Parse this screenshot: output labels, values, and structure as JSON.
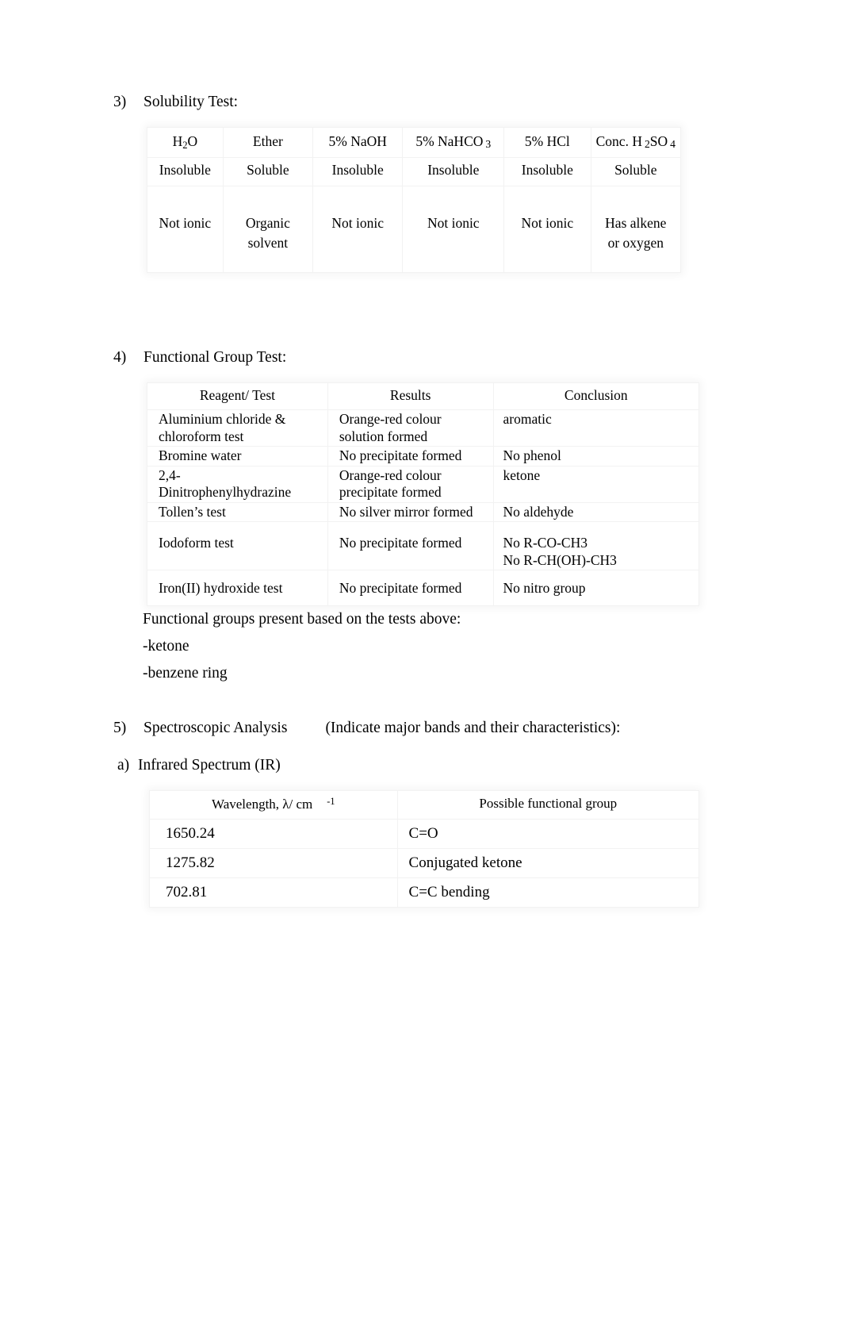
{
  "document": {
    "type": "lab-report-page",
    "background_color": "#ffffff",
    "text_color": "#000000"
  },
  "sections": {
    "solubility": {
      "marker": "3)",
      "title": "Solubility Test:",
      "table": {
        "headers": [
          {
            "text": "H",
            "sub": "2",
            "tail": "O"
          },
          {
            "text": "Ether",
            "sub": "",
            "tail": ""
          },
          {
            "text": "5% NaOH",
            "sub": "",
            "tail": ""
          },
          {
            "text": "5% NaHCO",
            "sub": "3",
            "tail": ""
          },
          {
            "text": "5% HCl",
            "sub": "",
            "tail": ""
          },
          {
            "text": "Conc. H",
            "sub": "2",
            "tail": "SO",
            "sub2": "4"
          }
        ],
        "header_plain": [
          "H2O",
          "Ether",
          "5% NaOH",
          "5% NaHCO 3",
          "5% HCl",
          "Conc. H 2SO 4"
        ],
        "results": [
          "Insoluble",
          "Soluble",
          "Insoluble",
          "Insoluble",
          "Insoluble",
          "Soluble"
        ],
        "conclusions": [
          [
            "Not ionic"
          ],
          [
            "Organic",
            "solvent"
          ],
          [
            "Not ionic"
          ],
          [
            "Not ionic"
          ],
          [
            "Not ionic"
          ],
          [
            "Has alkene",
            "or oxygen"
          ]
        ]
      }
    },
    "functional_group": {
      "marker": "4)",
      "title": "Functional Group Test:",
      "table": {
        "headers": [
          "Reagent/ Test",
          "Results",
          "Conclusion"
        ],
        "rows": [
          {
            "reagent": [
              "Aluminium chloride &",
              "chloroform test"
            ],
            "results": [
              "Orange-red colour",
              "solution formed"
            ],
            "conclusion": [
              "aromatic"
            ]
          },
          {
            "reagent": [
              "Bromine water"
            ],
            "results": [
              "No precipitate formed"
            ],
            "conclusion": [
              "No phenol"
            ]
          },
          {
            "reagent": [
              "2,4-",
              "Dinitrophenylhydrazine"
            ],
            "results": [
              "Orange-red colour",
              "precipitate formed"
            ],
            "conclusion": [
              "ketone"
            ]
          },
          {
            "reagent": [
              "Tollen’s test"
            ],
            "results": [
              "No silver mirror formed"
            ],
            "conclusion": [
              "No aldehyde"
            ]
          },
          {
            "reagent": [
              "Iodoform test"
            ],
            "results": [
              "No precipitate formed"
            ],
            "conclusion": [
              "No  R-CO-CH3",
              "No  R-CH(OH)-CH3"
            ]
          },
          {
            "reagent": [
              "Iron(II) hydroxide test"
            ],
            "results": [
              "No precipitate formed"
            ],
            "conclusion": [
              "No nitro group"
            ]
          }
        ]
      },
      "summary_heading": "Functional groups present based on the tests above:",
      "summary_items": [
        "-ketone",
        "-benzene ring"
      ]
    },
    "spectroscopic": {
      "marker": "5)",
      "title": "Spectroscopic Analysis",
      "note": "(Indicate major bands and their characteristics):",
      "subsection": {
        "marker": "a)",
        "title": "Infrared Spectrum (IR)"
      },
      "ir_table": {
        "headers": {
          "wavelength": "Wavelength, λ/ cm",
          "wavelength_superscript": "-1",
          "functional_group": "Possible functional group"
        },
        "rows": [
          {
            "wavelength": "1650.24",
            "group": "C=O"
          },
          {
            "wavelength": "1275.82",
            "group": "Conjugated ketone"
          },
          {
            "wavelength": "702.81",
            "group": "C=C bending"
          }
        ]
      }
    }
  }
}
